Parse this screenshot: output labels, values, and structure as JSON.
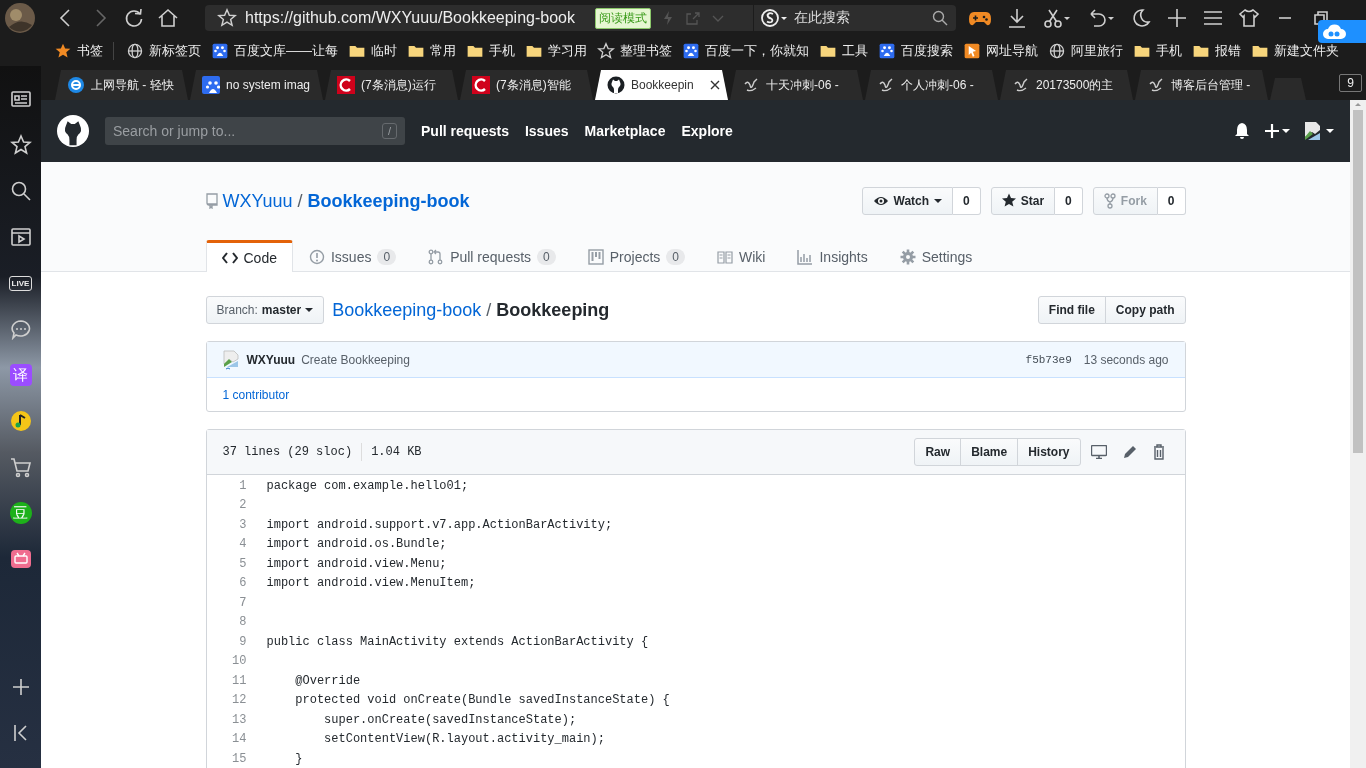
{
  "browser": {
    "url": "https://github.com/WXYuuu/Bookkeeping-book",
    "reader_badge": "阅读模式",
    "search_placeholder": "在此搜索",
    "tab_count": "9"
  },
  "bookmarks": [
    {
      "label": "书签",
      "kind": "bookmarks"
    },
    {
      "label": "新标签页",
      "kind": "globe"
    },
    {
      "label": "百度文库——让每",
      "kind": "baidu"
    },
    {
      "label": "临时",
      "kind": "folder"
    },
    {
      "label": "常用",
      "kind": "folder"
    },
    {
      "label": "手机",
      "kind": "folder"
    },
    {
      "label": "学习用",
      "kind": "folder"
    },
    {
      "label": "整理书签",
      "kind": "star"
    },
    {
      "label": "百度一下，你就知",
      "kind": "baidu"
    },
    {
      "label": "工具",
      "kind": "folder"
    },
    {
      "label": "百度搜索",
      "kind": "baidu"
    },
    {
      "label": "网址导航",
      "kind": "nav"
    },
    {
      "label": "阿里旅行",
      "kind": "globe"
    },
    {
      "label": "手机",
      "kind": "folder"
    },
    {
      "label": "报错",
      "kind": "folder"
    },
    {
      "label": "新建文件夹",
      "kind": "folder"
    }
  ],
  "tabs": [
    {
      "title": "上网导航 - 轻快",
      "kind": "ie",
      "selected": false
    },
    {
      "title": "no system imag",
      "kind": "baidu",
      "selected": false
    },
    {
      "title": "(7条消息)运行",
      "kind": "csdn",
      "selected": false
    },
    {
      "title": "(7条消息)智能",
      "kind": "csdn",
      "selected": false
    },
    {
      "title": "Bookkeepin",
      "kind": "github",
      "selected": true
    },
    {
      "title": "十天冲刺-06 -",
      "kind": "blog",
      "selected": false
    },
    {
      "title": "个人冲刺-06 -",
      "kind": "blog",
      "selected": false
    },
    {
      "title": "20173500的主",
      "kind": "blog",
      "selected": false
    },
    {
      "title": "博客后台管理 -",
      "kind": "blog",
      "selected": false
    }
  ],
  "sidebar": {
    "items": [
      {
        "kind": "reader"
      },
      {
        "kind": "star"
      },
      {
        "kind": "search"
      },
      {
        "kind": "video"
      },
      {
        "kind": "live",
        "label": "LIVE"
      },
      {
        "kind": "chat"
      },
      {
        "kind": "translate",
        "label": "译"
      },
      {
        "kind": "music"
      },
      {
        "kind": "cart"
      },
      {
        "kind": "douban",
        "label": "豆"
      },
      {
        "kind": "video-app"
      },
      {
        "kind": "add"
      },
      {
        "kind": "collapse"
      }
    ]
  },
  "github": {
    "search_placeholder": "Search or jump to...",
    "search_key": "/",
    "nav": [
      "Pull requests",
      "Issues",
      "Marketplace",
      "Explore"
    ]
  },
  "repo": {
    "owner": "WXYuuu",
    "separator": "/",
    "name": "Bookkeeping-book",
    "actions": [
      {
        "label": "Watch",
        "kind": "watch",
        "count": "0",
        "caret": true,
        "disabled": false
      },
      {
        "label": "Star",
        "kind": "star",
        "count": "0",
        "caret": false,
        "disabled": false
      },
      {
        "label": "Fork",
        "kind": "fork",
        "count": "0",
        "caret": false,
        "disabled": true
      }
    ],
    "tabs": [
      {
        "label": "Code",
        "kind": "code",
        "selected": true
      },
      {
        "label": "Issues",
        "kind": "issues",
        "count": "0",
        "selected": false
      },
      {
        "label": "Pull requests",
        "kind": "pulls",
        "count": "0",
        "selected": false
      },
      {
        "label": "Projects",
        "kind": "projects",
        "count": "0",
        "selected": false
      },
      {
        "label": "Wiki",
        "kind": "wiki",
        "selected": false
      },
      {
        "label": "Insights",
        "kind": "insights",
        "selected": false
      },
      {
        "label": "Settings",
        "kind": "settings",
        "selected": false
      }
    ]
  },
  "file": {
    "branch_label": "Branch:",
    "branch": "master",
    "path": [
      "Bookkeeping-book",
      "Bookkeeping"
    ],
    "path_separator": "/",
    "buttons": [
      "Find file",
      "Copy path"
    ],
    "commit": {
      "author": "WXYuuu",
      "message": "Create Bookkeeping",
      "sha": "f5b73e9",
      "time": "13 seconds ago"
    },
    "contributors": {
      "count": "1",
      "label": "contributor"
    },
    "info": [
      "37 lines (29 sloc)",
      "1.04 KB"
    ],
    "view_buttons": [
      "Raw",
      "Blame",
      "History"
    ],
    "lines": [
      {
        "number": "1",
        "code": "package com.example.hello01;"
      },
      {
        "number": "2"
      },
      {
        "number": "3",
        "code": "import android.support.v7.app.ActionBarActivity;"
      },
      {
        "number": "4",
        "code": "import android.os.Bundle;"
      },
      {
        "number": "5",
        "code": "import android.view.Menu;"
      },
      {
        "number": "6",
        "code": "import android.view.MenuItem;"
      },
      {
        "number": "7"
      },
      {
        "number": "8"
      },
      {
        "number": "9",
        "code": "public class MainActivity extends ActionBarActivity {"
      },
      {
        "number": "10"
      },
      {
        "number": "11",
        "code": "    @Override"
      },
      {
        "number": "12",
        "code": "    protected void onCreate(Bundle savedInstanceState) {"
      },
      {
        "number": "13",
        "code": "        super.onCreate(savedInstanceState);"
      },
      {
        "number": "14",
        "code": "        setContentView(R.layout.activity_main);"
      },
      {
        "number": "15",
        "code": "    }"
      }
    ]
  }
}
